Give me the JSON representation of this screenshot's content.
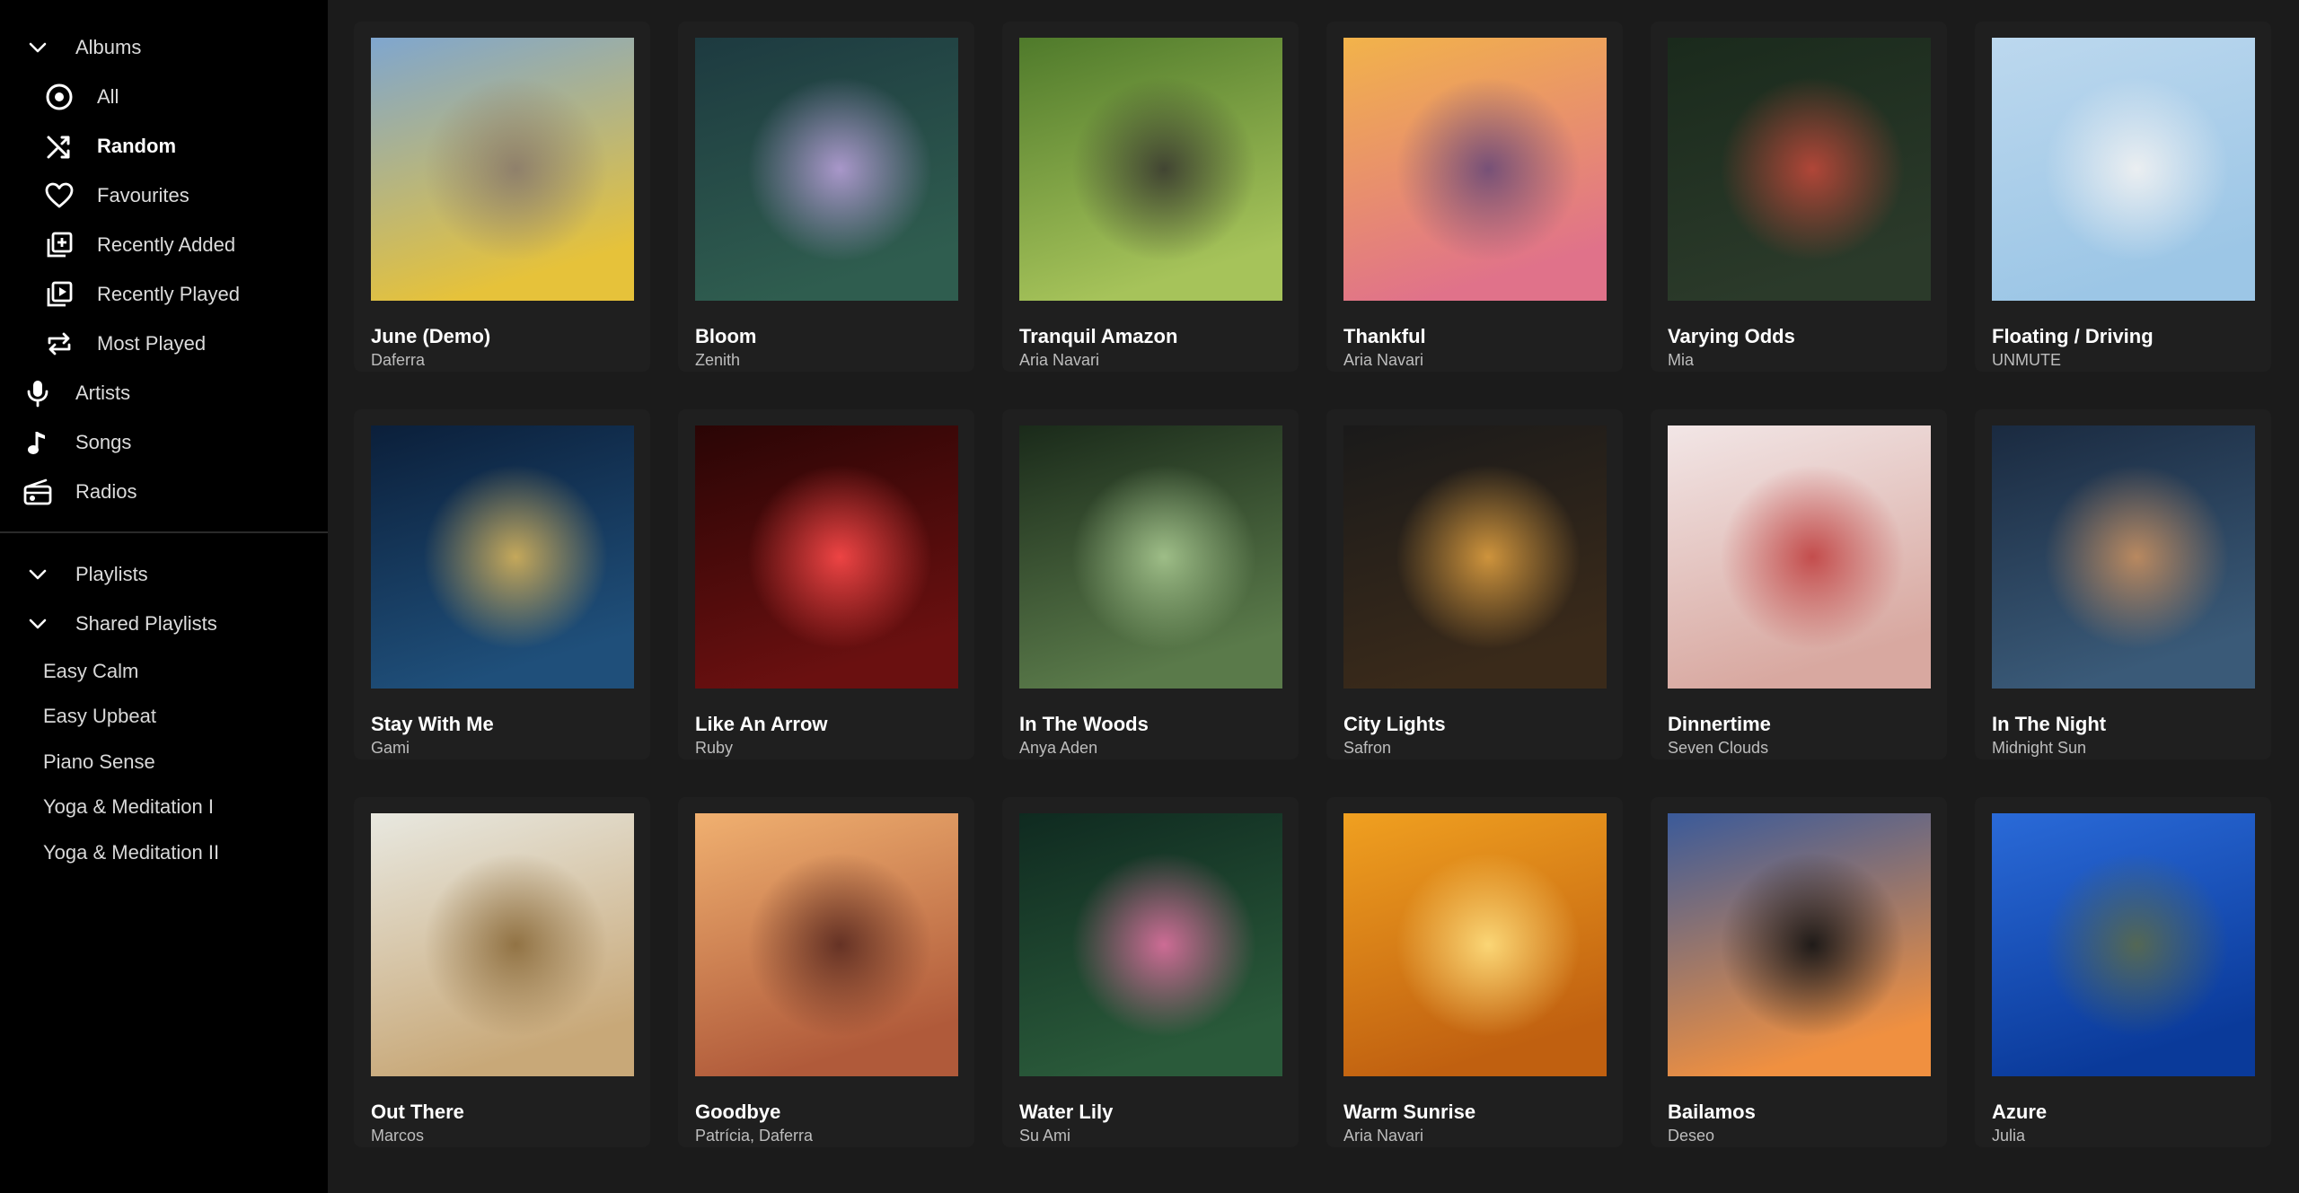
{
  "sidebar": {
    "albums": {
      "label": "Albums",
      "items": [
        {
          "label": "All",
          "icon": "disc-icon"
        },
        {
          "label": "Random",
          "icon": "shuffle-icon",
          "selected": true
        },
        {
          "label": "Favourites",
          "icon": "heart-icon"
        },
        {
          "label": "Recently Added",
          "icon": "add-library-icon"
        },
        {
          "label": "Recently Played",
          "icon": "play-library-icon"
        },
        {
          "label": "Most Played",
          "icon": "repeat-icon"
        }
      ]
    },
    "artists_label": "Artists",
    "songs_label": "Songs",
    "radios_label": "Radios",
    "playlists_label": "Playlists",
    "shared_playlists": {
      "label": "Shared Playlists",
      "items": [
        "Easy Calm",
        "Easy Upbeat",
        "Piano Sense",
        "Yoga & Meditation I",
        "Yoga & Meditation II"
      ]
    }
  },
  "albums": [
    {
      "title": "June (Demo)",
      "artist": "Daferra",
      "colors": [
        "#7fa6cf",
        "#e6c23a",
        "#8a7a6a"
      ]
    },
    {
      "title": "Bloom",
      "artist": "Zenith",
      "colors": [
        "#1d3a40",
        "#2f5d4f",
        "#b79fd8"
      ]
    },
    {
      "title": "Tranquil Amazon",
      "artist": "Aria Navari",
      "colors": [
        "#4f7a2b",
        "#a6c35a",
        "#3a3a30"
      ]
    },
    {
      "title": "Thankful",
      "artist": "Aria Navari",
      "colors": [
        "#f2b34a",
        "#e0728a",
        "#6a4a78"
      ]
    },
    {
      "title": "Varying Odds",
      "artist": "Mia",
      "colors": [
        "#1a2a1c",
        "#2b3a2a",
        "#c0483a"
      ]
    },
    {
      "title": "Floating / Driving",
      "artist": "UNMUTE",
      "colors": [
        "#bcd8ee",
        "#9cc6e6",
        "#f2f2f2"
      ]
    },
    {
      "title": "Stay With Me",
      "artist": "Gami",
      "colors": [
        "#0b1f3a",
        "#1f4f7a",
        "#d8b45a"
      ]
    },
    {
      "title": "Like An Arrow",
      "artist": "Ruby",
      "colors": [
        "#2a0505",
        "#6a1010",
        "#ff4a4a"
      ]
    },
    {
      "title": "In The Woods",
      "artist": "Anya Aden",
      "colors": [
        "#1a2a1a",
        "#5a7a4a",
        "#a8c890"
      ]
    },
    {
      "title": "City Lights",
      "artist": "Safron",
      "colors": [
        "#1a1a1a",
        "#3a2a1a",
        "#e0a040"
      ]
    },
    {
      "title": "Dinnertime",
      "artist": "Seven Clouds",
      "colors": [
        "#f2e6e6",
        "#d8a8a0",
        "#c04040"
      ]
    },
    {
      "title": "In The Night",
      "artist": "Midnight Sun",
      "colors": [
        "#1a2a40",
        "#3a5a78",
        "#c89060"
      ]
    },
    {
      "title": "Out There",
      "artist": "Marcos",
      "colors": [
        "#e8e8e0",
        "#c8a878",
        "#8a6a3a"
      ]
    },
    {
      "title": "Goodbye",
      "artist": "Patrícia, Daferra",
      "colors": [
        "#f0b070",
        "#b05a3a",
        "#5a2a20"
      ]
    },
    {
      "title": "Water Lily",
      "artist": "Su Ami",
      "colors": [
        "#0f2a20",
        "#2a5a3a",
        "#e070a0"
      ]
    },
    {
      "title": "Warm Sunrise",
      "artist": "Aria Navari",
      "colors": [
        "#f0a020",
        "#c06010",
        "#ffe080"
      ]
    },
    {
      "title": "Bailamos",
      "artist": "Deseo",
      "colors": [
        "#3a5a9a",
        "#f09040",
        "#101010"
      ]
    },
    {
      "title": "Azure",
      "artist": "Julia",
      "colors": [
        "#2a6ad8",
        "#0a3a9a",
        "#5a6a4a"
      ]
    }
  ]
}
